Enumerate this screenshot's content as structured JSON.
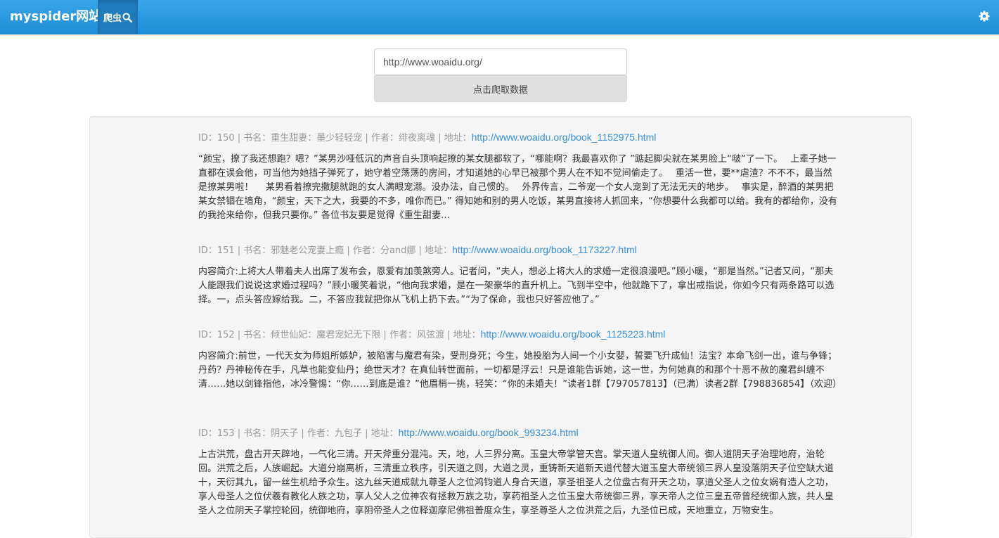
{
  "navbar": {
    "brand": "myspider网站",
    "active_tab_label": "爬虫",
    "search_icon": "search-icon",
    "settings_icon": "gear-icon"
  },
  "search": {
    "url_value": "http://www.woaidu.org/",
    "button_label": "点击爬取数据"
  },
  "books": [
    {
      "meta_prefix": "ID：150 | 书名：重生甜妻：墨少轻轻宠 | 作者：绯夜离魂 | 地址：",
      "url": "http://www.woaidu.org/book_1152975.html",
      "description": "“颜宝，撩了我还想跑？嗯？”某男沙哑低沉的声音自头顶响起撩的某女腿都软了，“哪能啊？我最喜欢你了 ”踮起脚尖就在某男脸上“啵”了一下。　 上辈子她一直都在误会他，可当他为她挡子弹死了，她守着空荡荡的房间，才知道她的心早已被那个男人在不知不觉间偷走了。　 重活一世，要**虐渣？不不不，最当然是撩某男啦！　 某男看着撩完撒腿就跑的女人满眼宠溺。没办法，自己惯的。　 外界传言，二爷宠一个女人宠到了无法无天的地步。　 事实是，醉酒的某男把某女禁锢在墙角，“颜宝，天下之大，我要的不多，唯你而已。” 得知她和别的男人吃饭，某男直接将人抓回来，“你想要什么我都可以给。我有的都给你，没有的我抢来给你，但我只要你。” 各位书友要是觉得《重生甜妻..."
    },
    {
      "meta_prefix": "ID：151 | 书名：邪魅老公宠妻上瘾 | 作者：分and娜 | 地址：",
      "url": "http://www.woaidu.org/book_1173227.html",
      "description": "内容简介:上将大人带着夫人出席了发布会，恩爱有加羡煞旁人。记者问，“夫人，想必上将大人的求婚一定很浪漫吧。”顾小暖，“那是当然。”记者又问，“那夫人能跟我们说说这求婚过程吗？”顾小暖笑着说，“他向我求婚，是在一架豪华的直升机上。飞到半空中，他就跪下了，拿出戒指说，你如今只有两条路可以选择。一，点头答应嫁给我。二，不答应我就把你从飞机上扔下去。”“为了保命，我也只好答应他了。”"
    },
    {
      "meta_prefix": "ID：152 | 书名：倾世仙妃：魔君宠妃无下限 | 作者：风弦渡 | 地址：",
      "url": "http://www.woaidu.org/book_1125223.html",
      "description": "内容简介:前世，一代天女为师姐所嫉妒，被陷害与魔君有染，受刑身死；今生，她投胎为人间一个小女婴，誓要飞升成仙！法宝？本命飞剑一出，谁与争锋；丹药？丹神秘传在手，凡草也能变仙丹；绝世天才？在真仙转世面前，一切都是浮云！只是谁能告诉她，这一世，为何她真的和那个十恶不赦的魔君纠缠不清……她以剑锋指他，冰冷警惕：“你……到底是谁？”他眉梢一挑，轻笑：“你的未婚夫！”读者1群【797057813】（已满）读者2群【798836854】（欢迎）"
    },
    {
      "meta_prefix": "ID：153 | 书名：阴天子 | 作者：九包子 | 地址：",
      "url": "http://www.woaidu.org/book_993234.html",
      "description": "上古洪荒，盘古开天辟地，一气化三清。开天斧重分混沌。天，地，人三界分离。玉皇大帝掌管天宫。掌天道人皇统御人间。御人道阴天子治理地府，治轮回。洪荒之后，人族崛起。大道分崩离析，三清重立秩序，引天道之则，大道之灵，重铸新天道新天道代替大道玉皇大帝统领三界人皇没落阴天子位空缺大道十，天衍其九，留一丝生机给予众生。这九丝天道成就九尊圣人之位鸿钧道人身合天道，享圣祖圣人之位盘古有开天之功，享道父圣人之位女娲有造人之功，享人母圣人之位伏羲有教化人族之功，享人父人之位神农有拯救万族之功，享药祖圣人之位玉皇大帝统御三界，享天帝人之位三皇五帝曾经统御人族，共人皇圣人之位阴天子掌控轮回，统御地府，享阴帝圣人之位释迦摩尼佛祖普度众生，享圣尊圣人之位洪荒之后，九圣位已成，天地重立，万物安生。"
    }
  ]
}
